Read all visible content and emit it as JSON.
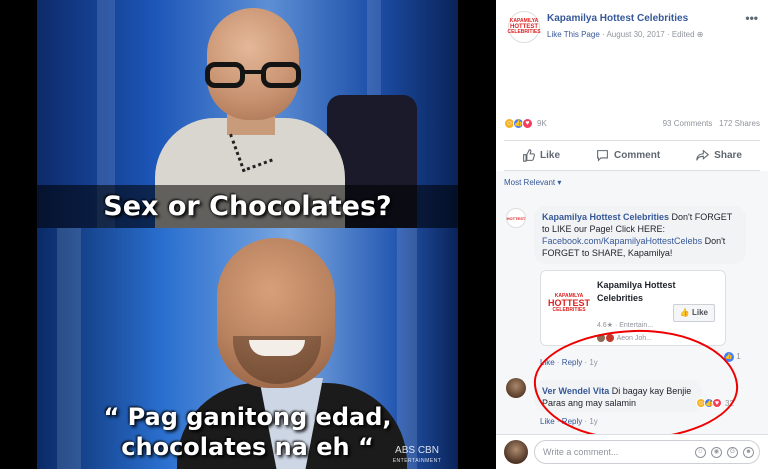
{
  "meme": {
    "caption_top": "Sex or Chocolates?",
    "caption_bottom_line1": "“ Pag ganitong edad,",
    "caption_bottom_line2": "chocolates na eh “",
    "watermark": "ABS CBN",
    "watermark_sub": "ENTERTAINMENT"
  },
  "post": {
    "page_name": "Kapamilya Hottest Celebrities",
    "like_link": "Like This Page",
    "date": "August 30, 2017",
    "edited": "Edited",
    "menu": "•••",
    "logo_text": [
      "KAPAMILYA",
      "HOTTEST",
      "CELEBRITIES"
    ]
  },
  "reactions": {
    "count": "9K",
    "comments": "93 Comments",
    "shares": "172 Shares",
    "icons": [
      "haha-icon",
      "like-icon",
      "love-icon"
    ]
  },
  "actions": {
    "like": "Like",
    "comment": "Comment",
    "share": "Share"
  },
  "comments": {
    "sort_label": "Most Relevant ▾",
    "first": {
      "author": "Kapamilya Hottest Celebrities",
      "text_a": " Don't FORGET to LIKE our Page! Click HERE: ",
      "link": "Facebook.com/KapamilyaHottestCelebs",
      "text_b": " Don't FORGET to SHARE, Kapamilya!",
      "card": {
        "title": "Kapamilya Hottest Celebrities",
        "rating": "4.6★ · Entertain...",
        "friends": "Aeon Joh...",
        "like_button": "Like"
      },
      "meta_like": "Like",
      "meta_reply": "Reply",
      "meta_time": "1y",
      "like_count": "1"
    },
    "second": {
      "author": "Ver Wendel Vita",
      "text": " Di bagay kay Benjie Paras ang may salamin",
      "meta_like": "Like",
      "meta_reply": "Reply",
      "meta_time": "1y",
      "reaction_count": "32"
    }
  },
  "composer": {
    "placeholder": "Write a comment...",
    "tools": [
      "emoji-icon",
      "camera-icon",
      "gif-icon",
      "sticker-icon"
    ]
  },
  "colors": {
    "fb_blue": "#365899",
    "like_blue": "#4080ff",
    "love_red": "#f33e58",
    "haha_yellow": "#f7b125",
    "annotation_red": "#ee0000"
  }
}
